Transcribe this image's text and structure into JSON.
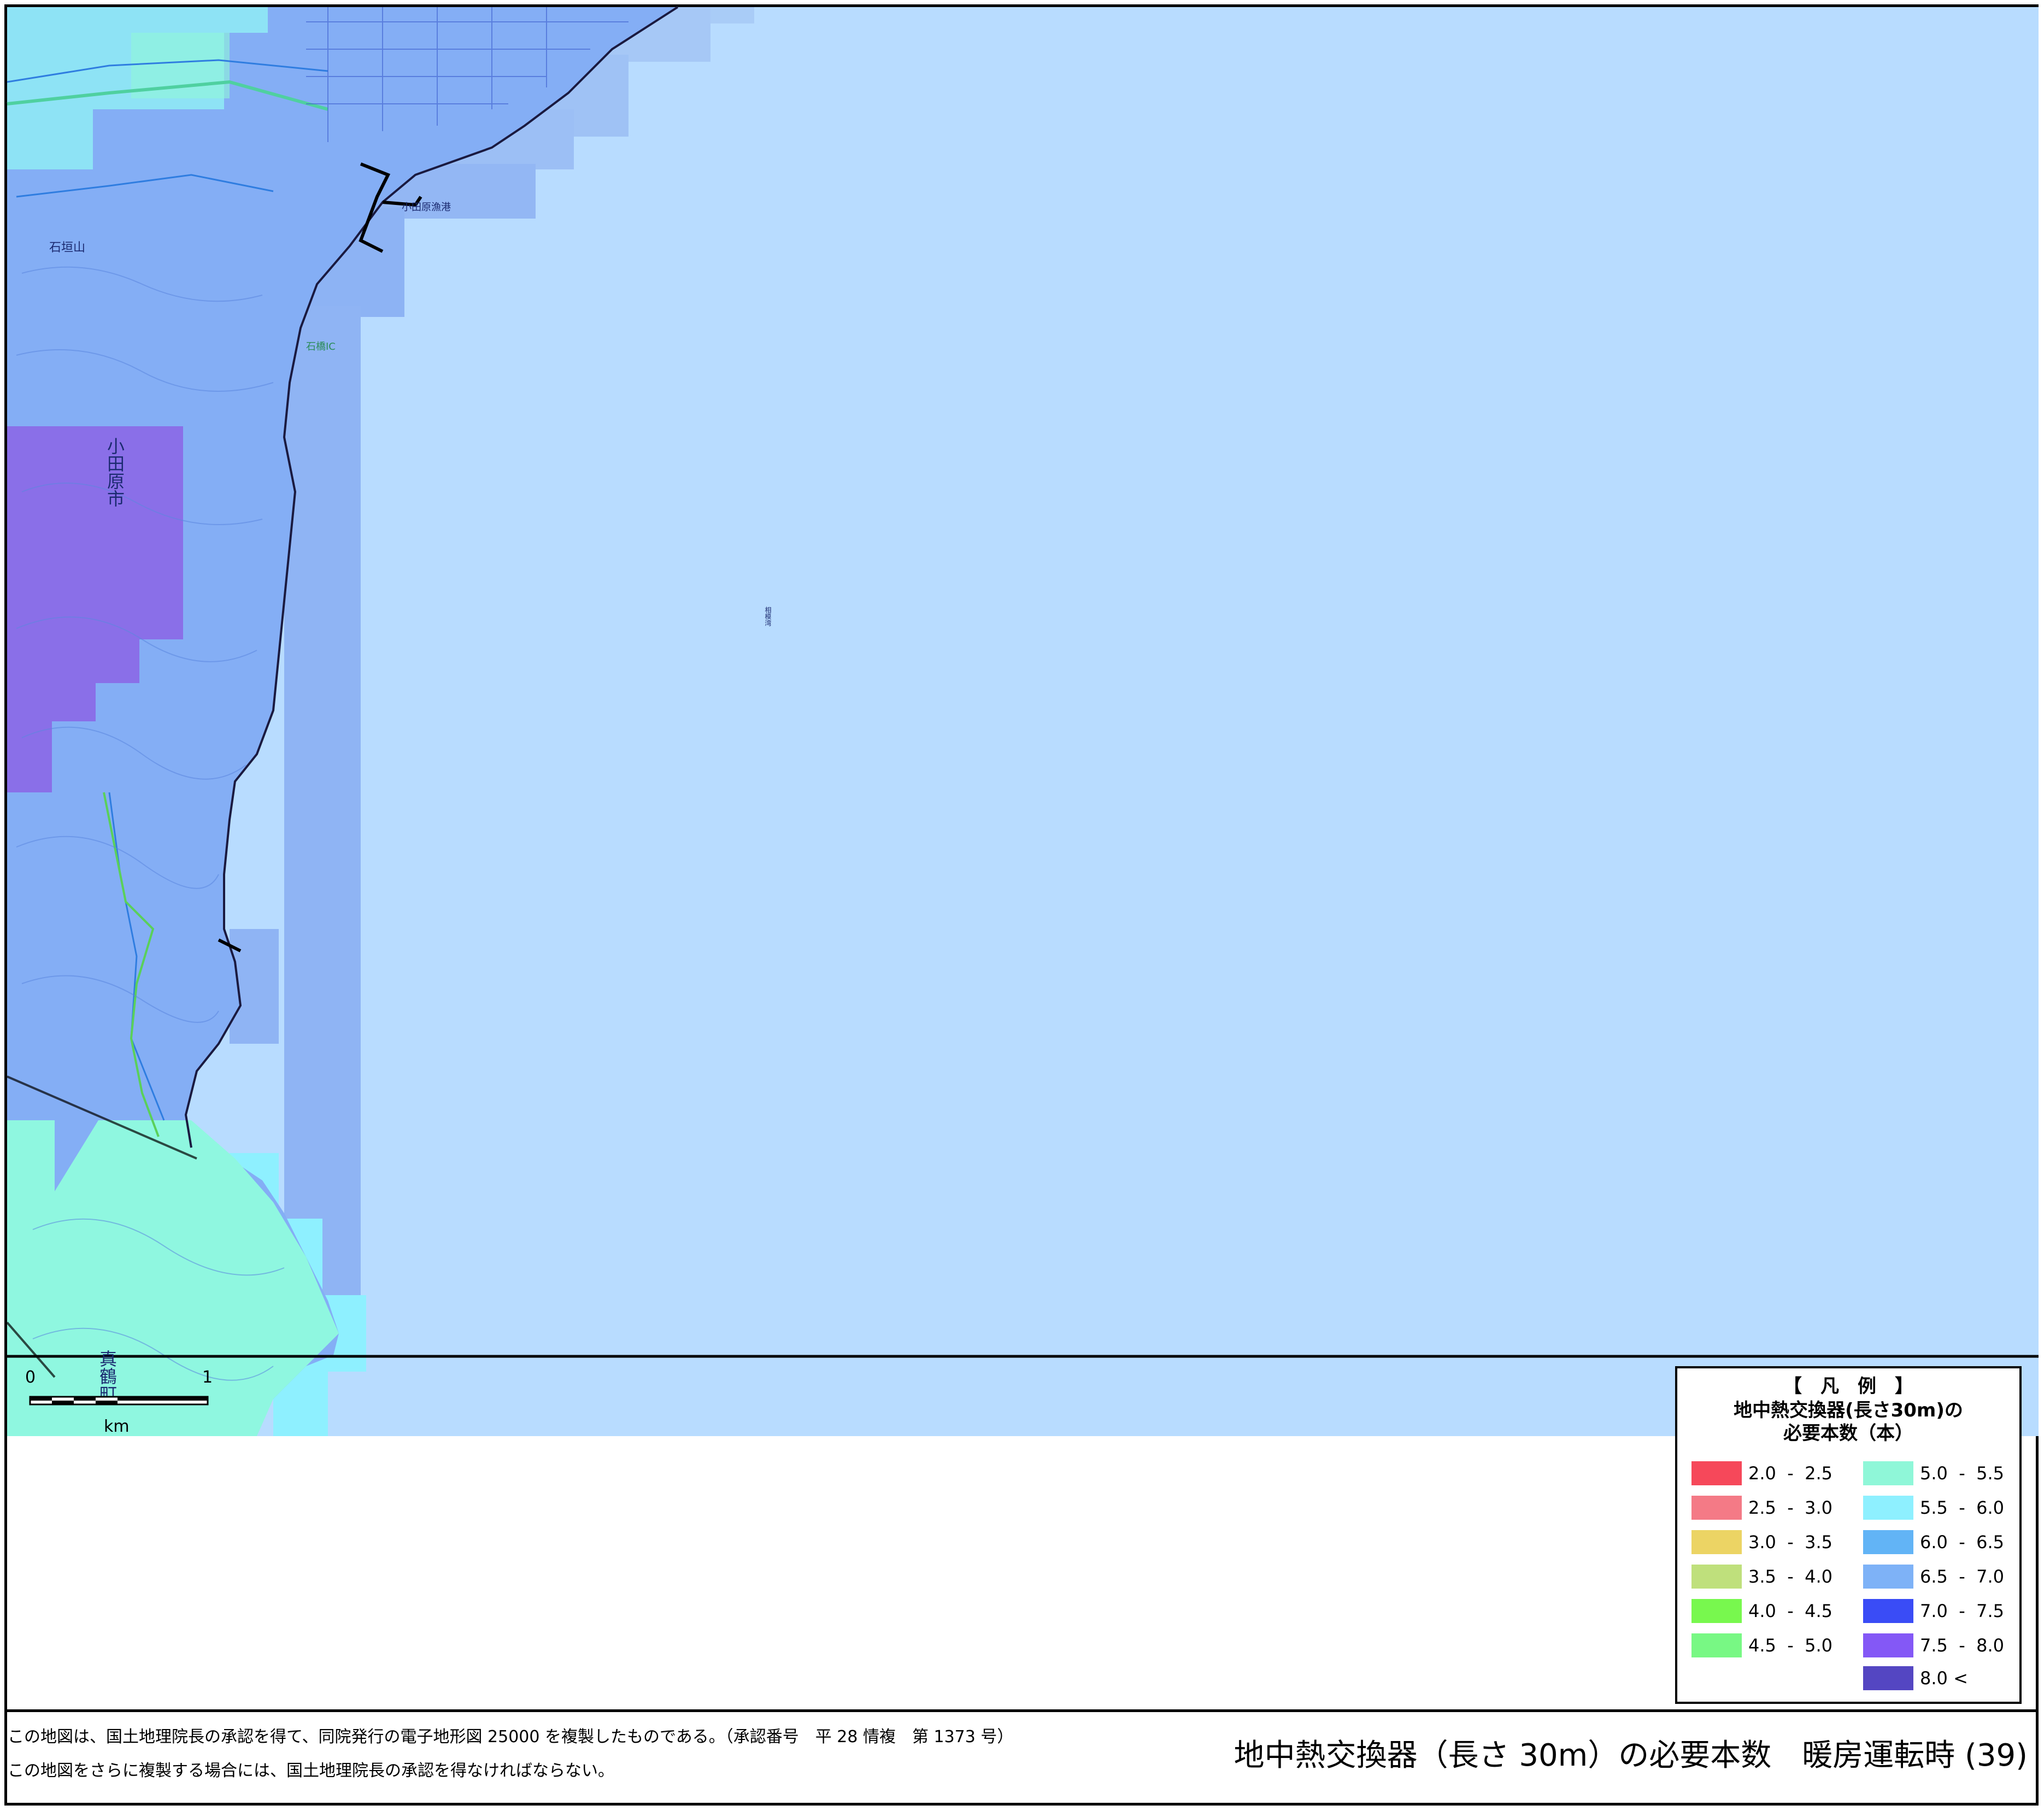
{
  "map": {
    "colors": {
      "sea": "#b8dcff",
      "land_6_5_7_0": "#84aef5",
      "land_6_0_6_5": "#78c4ff",
      "land_8_0": "#8a6fe8",
      "land_5_5_6_0": "#8ef0ff",
      "land_5_0_5_5": "#8ff7d8"
    },
    "place_labels": {
      "city": "小田原市",
      "town": "真鶴町",
      "mountain": "石垣山",
      "interchange": "石橋IC",
      "port": "小田原漁港",
      "bay": "相模湾"
    },
    "scale_bar": {
      "start": "0",
      "end": "1",
      "unit": "km"
    }
  },
  "legend": {
    "title": "【　凡　例　】",
    "subtitle_line1": "地中熱交換器(長さ30m)の",
    "subtitle_line2": "必要本数（本）",
    "items_left": [
      {
        "range": "2.0  -  2.5",
        "color": "#f6485a"
      },
      {
        "range": "2.5  -  3.0",
        "color": "#f47a86"
      },
      {
        "range": "3.0  -  3.5",
        "color": "#ecd464"
      },
      {
        "range": "3.5  -  4.0",
        "color": "#bfe07c"
      },
      {
        "range": "4.0  -  4.5",
        "color": "#78f84e"
      },
      {
        "range": "4.5  -  5.0",
        "color": "#78f884"
      }
    ],
    "items_right": [
      {
        "range": "5.0  -  5.5",
        "color": "#8ff7d8"
      },
      {
        "range": "5.5  -  6.0",
        "color": "#8ef0ff"
      },
      {
        "range": "6.0  -  6.5",
        "color": "#62b4f6"
      },
      {
        "range": "6.5  -  7.0",
        "color": "#7eb2f7"
      },
      {
        "range": "7.0  -  7.5",
        "color": "#3a4cf6"
      },
      {
        "range": "7.5  -  8.0",
        "color": "#8458f6"
      },
      {
        "range": "8.0 <",
        "color": "#5446c2"
      }
    ]
  },
  "footer": {
    "note_line1": "この地図は、国土地理院長の承認を得て、同院発行の電子地形図 25000 を複製したものである。（承認番号　平 28 情複　第 1373 号）",
    "note_line2": "この地図をさらに複製する場合には、国土地理院長の承認を得なければならない。",
    "title": "地中熱交換器（長さ 30m）の必要本数　暖房運転時 (39)"
  }
}
